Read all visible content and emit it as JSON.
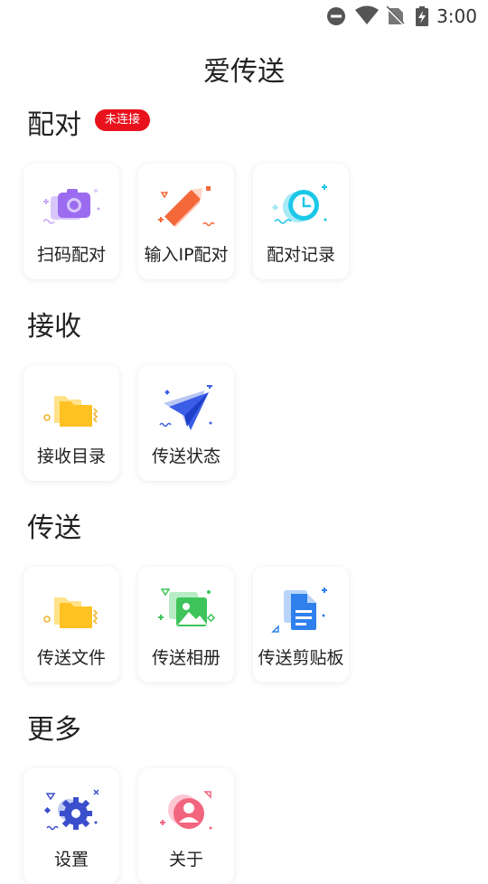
{
  "status_bar": {
    "time": "3:00",
    "icons": [
      "dnd-icon",
      "wifi-icon",
      "no-sim-icon",
      "battery-charging-icon"
    ]
  },
  "app": {
    "title": "爱传送"
  },
  "sections": {
    "pair": {
      "title": "配对",
      "badge": "未连接",
      "items": [
        {
          "label": "扫码配对",
          "icon": "camera-scan-icon"
        },
        {
          "label": "输入IP配对",
          "icon": "pencil-icon"
        },
        {
          "label": "配对记录",
          "icon": "clock-icon"
        }
      ]
    },
    "receive": {
      "title": "接收",
      "items": [
        {
          "label": "接收目录",
          "icon": "folder-icon"
        },
        {
          "label": "传送状态",
          "icon": "paper-plane-icon"
        }
      ]
    },
    "send": {
      "title": "传送",
      "items": [
        {
          "label": "传送文件",
          "icon": "folder-icon"
        },
        {
          "label": "传送相册",
          "icon": "image-icon"
        },
        {
          "label": "传送剪贴板",
          "icon": "document-icon"
        }
      ]
    },
    "more": {
      "title": "更多",
      "items": [
        {
          "label": "设置",
          "icon": "gear-icon"
        },
        {
          "label": "关于",
          "icon": "user-icon"
        }
      ]
    }
  }
}
